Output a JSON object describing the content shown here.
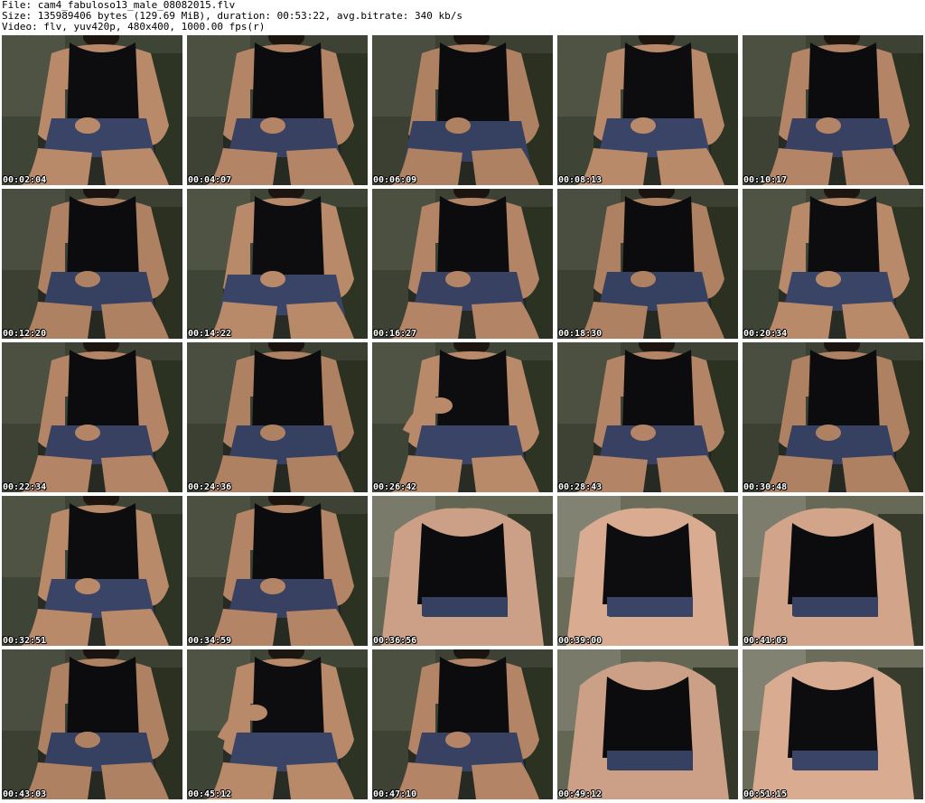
{
  "header": {
    "file_line": "File: cam4_fabuloso13_male_08082015.flv",
    "size_line": "Size: 135989406 bytes (129.69 MiB), duration: 00:53:22, avg.bitrate: 340 kb/s",
    "video_line": "Video: flv, yuv420p, 480x400, 1000.00 fps(r)"
  },
  "thumbnails": [
    {
      "timestamp": "00:02:04",
      "pose": "seated"
    },
    {
      "timestamp": "00:04:07",
      "pose": "seated"
    },
    {
      "timestamp": "00:06:09",
      "pose": "seated-wide"
    },
    {
      "timestamp": "00:08:13",
      "pose": "seated"
    },
    {
      "timestamp": "00:10:17",
      "pose": "seated"
    },
    {
      "timestamp": "00:12:20",
      "pose": "seated"
    },
    {
      "timestamp": "00:14:22",
      "pose": "seated-wide"
    },
    {
      "timestamp": "00:16:27",
      "pose": "seated"
    },
    {
      "timestamp": "00:18:30",
      "pose": "seated"
    },
    {
      "timestamp": "00:20:34",
      "pose": "seated"
    },
    {
      "timestamp": "00:22:34",
      "pose": "seated"
    },
    {
      "timestamp": "00:24:36",
      "pose": "seated"
    },
    {
      "timestamp": "00:26:42",
      "pose": "seated-arm-raised"
    },
    {
      "timestamp": "00:28:43",
      "pose": "seated"
    },
    {
      "timestamp": "00:30:48",
      "pose": "seated"
    },
    {
      "timestamp": "00:32:51",
      "pose": "seated"
    },
    {
      "timestamp": "00:34:59",
      "pose": "seated"
    },
    {
      "timestamp": "00:36:56",
      "pose": "close-bright"
    },
    {
      "timestamp": "00:39:00",
      "pose": "close-bright"
    },
    {
      "timestamp": "00:41:03",
      "pose": "close-bright"
    },
    {
      "timestamp": "00:43:03",
      "pose": "seated"
    },
    {
      "timestamp": "00:45:12",
      "pose": "seated-arm-raised"
    },
    {
      "timestamp": "00:47:10",
      "pose": "seated"
    },
    {
      "timestamp": "00:49:12",
      "pose": "close-bright"
    },
    {
      "timestamp": "00:51:15",
      "pose": "close-bright"
    }
  ],
  "colors": {
    "background": "#ffffff",
    "header_text": "#000000",
    "timestamp_text": "#ffffff",
    "timestamp_outline": "#000000",
    "tank_top": "#0d0d0f",
    "shorts": "#3a4466",
    "skin": "#b98a6a",
    "skin_bright": "#d9ab90",
    "backdrop": "#3f4536"
  }
}
